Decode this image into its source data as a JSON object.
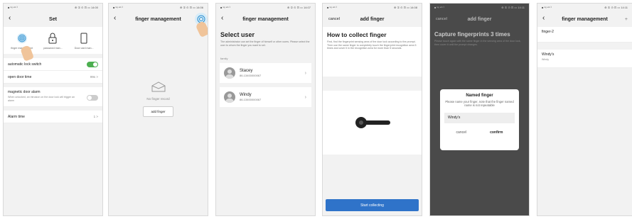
{
  "phones": {
    "p1": {
      "status_left": "■ ⁵ᵍ ⁴ᴳ ⁱˡ",
      "status_right": "⊕ ① ⊙ ⊡ ▭ 14:00",
      "title": "Set",
      "icon1_label": "finger management",
      "icon2_label": "password man...",
      "icon3_label": "Door card man...",
      "row1_label": "automatic lock switch",
      "row2_label": "open door time",
      "row2_value": "99s >",
      "row3_label": "magnetic door alarm",
      "row3_desc": "When unlocked, an intrusion on the door lock will trigger an alarm",
      "row4_label": "Alarm time",
      "row4_value": "1 >"
    },
    "p2": {
      "status_left": "■ ⁵ᵍ ⁴ᴳ ⁱˡ",
      "status_right": "⊕ ① ⊙ ⊡ ▭ 14:06",
      "title": "finger management",
      "empty_text": "No finger record",
      "add_button": "add finger"
    },
    "p3": {
      "status_left": "■ ⁵ᵍ ⁴ᴳ ⁱˡ",
      "status_right": "⊕ ① ⊙ ⊡ ▭ 14:07",
      "title": "finger management",
      "heading": "Select user",
      "desc": "The administrator can set the finger of himself or other users. Please select the user to whom the finger you want to set.",
      "section": "family",
      "users": [
        {
          "name": "Stacey",
          "phone": "86-13400000067"
        },
        {
          "name": "Windy",
          "phone": "86-13400000067"
        }
      ]
    },
    "p4": {
      "status_left": "■ ⁵ᵍ ⁴ᴳ ⁱˡ",
      "status_right": "⊕ ① ⊙ ⊡ ▭ 14:08",
      "cancel": "cancel",
      "title": "add finger",
      "heading": "How to collect finger",
      "desc": "First, find the fingerprint sensing area of the door lock according to the prompt. Then use the same finger to completely touch the fingerprint recognition area 5 times and cover it in the recognition area for more than 5 seconds.",
      "button": "Start collecting"
    },
    "p5": {
      "status_left": "■ ⁵ᵍ ⁴ᴳ ⁱˡ",
      "status_right": "⊕ ① ⊙ ⊡ ▭ 14:11",
      "cancel": "cancel",
      "title": "add finger",
      "heading": "Capture fingerprints 3 times",
      "desc": "Please touch again with the same finger in the sensing area of the door lock, then cover it until the prompt changes.",
      "dialog_title": "Named finger",
      "dialog_desc": "Please name your finger, note that the finger named name is not repeatable",
      "input_value": "Windy's",
      "dialog_cancel": "cancel",
      "dialog_confirm": "confirm"
    },
    "p6": {
      "status_left": "■ ⁵ᵍ ⁴ᴳ ⁱˡ",
      "status_right": "⊕ ① ⊙ ⊡ ▭ 14:11",
      "title": "finger management",
      "plus": "+",
      "finger1": "finger-2",
      "finger2": "Windy's",
      "finger2_sub": "Windy"
    }
  }
}
